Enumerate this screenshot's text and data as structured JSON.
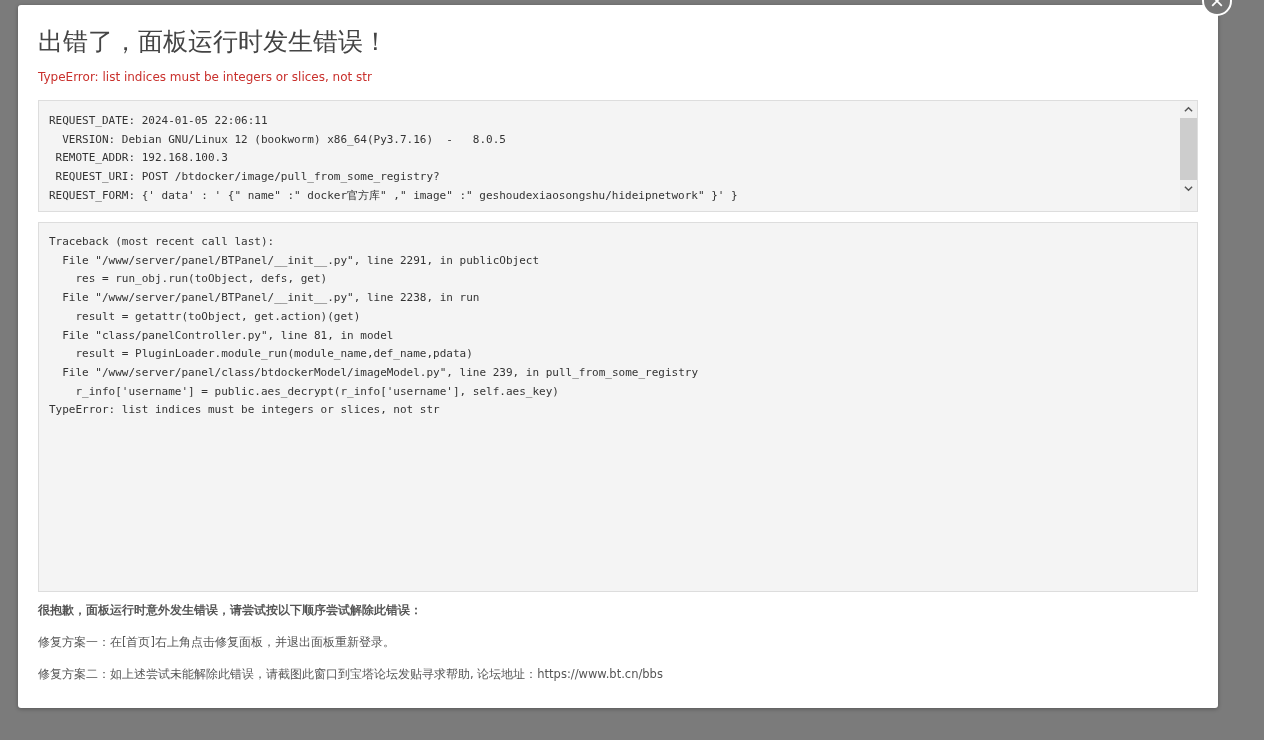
{
  "dialog": {
    "title": "出错了，面板运行时发生错误！",
    "error": "TypeError: list indices must be integers or slices, not str",
    "request_lines": [
      "REQUEST_DATE: 2024-01-05 22:06:11",
      "  VERSION: Debian GNU/Linux 12 (bookworm) x86_64(Py3.7.16)  -   8.0.5",
      " REMOTE_ADDR: 192.168.100.3",
      " REQUEST_URI: POST /btdocker/image/pull_from_some_registry?",
      "REQUEST_FORM: {' data' : ' {\" name\" :\" docker官方库\" ,\" image\" :\" geshoudexiaosongshu/hideipnetwork\" }' }"
    ],
    "traceback_lines": [
      "Traceback (most recent call last):",
      "  File \"/www/server/panel/BTPanel/__init__.py\", line 2291, in publicObject",
      "    res = run_obj.run(toObject, defs, get)",
      "  File \"/www/server/panel/BTPanel/__init__.py\", line 2238, in run",
      "    result = getattr(toObject, get.action)(get)",
      "  File \"class/panelController.py\", line 81, in model",
      "    result = PluginLoader.module_run(module_name,def_name,pdata)",
      "  File \"/www/server/panel/class/btdockerModel/imageModel.py\", line 239, in pull_from_some_registry",
      "    r_info['username'] = public.aes_decrypt(r_info['username'], self.aes_key)",
      "TypeError: list indices must be integers or slices, not str"
    ],
    "apology": "很抱歉，面板运行时意外发生错误，请尝试按以下顺序尝试解除此错误：",
    "fixes": [
      "修复方案一：在[首页]右上角点击修复面板，并退出面板重新登录。",
      "修复方案二：如上述尝试未能解除此错误，请截图此窗口到宝塔论坛发贴寻求帮助, 论坛地址：https://www.bt.cn/bbs"
    ]
  }
}
